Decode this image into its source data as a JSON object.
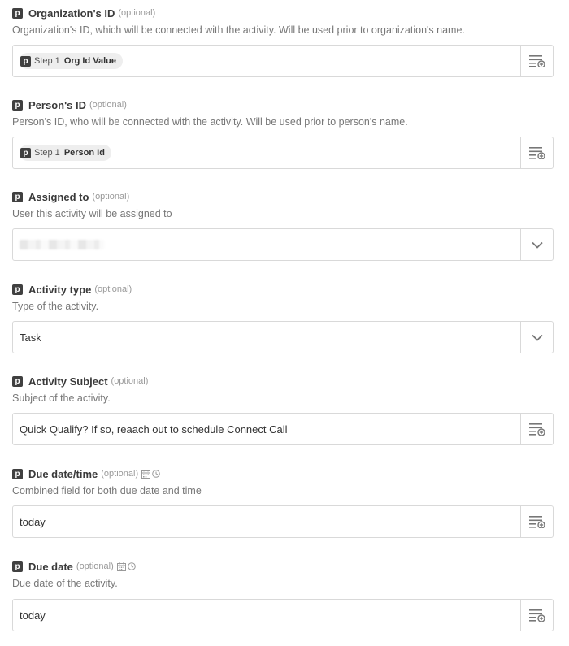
{
  "fields": [
    {
      "label": "Organization's ID",
      "optional": "(optional)",
      "description": "Organization's ID, which will be connected with the activity. Will be used prior to organization's name.",
      "pill": {
        "step": "Step 1",
        "value": "Org Id  Value"
      }
    },
    {
      "label": "Person's ID",
      "optional": "(optional)",
      "description": "Person's ID, who will be connected with the activity. Will be used prior to person's name.",
      "pill": {
        "step": "Step 1",
        "value": "Person  Id"
      }
    },
    {
      "label": "Assigned to",
      "optional": "(optional)",
      "description": "User this activity will be assigned to",
      "value": ""
    },
    {
      "label": "Activity type",
      "optional": "(optional)",
      "description": "Type of the activity.",
      "value": "Task"
    },
    {
      "label": "Activity Subject",
      "optional": "(optional)",
      "description": "Subject of the activity.",
      "value": "Quick Qualify? If so, reaach out to schedule Connect Call"
    },
    {
      "label": "Due date/time",
      "optional": "(optional)",
      "description": "Combined field for both due date and time",
      "value": "today"
    },
    {
      "label": "Due date",
      "optional": "(optional)",
      "description": "Due date of the activity.",
      "value": "today"
    }
  ],
  "app_badge": "p",
  "icons": {
    "field_menu": "list-plus-icon",
    "dropdown": "chevron-down-icon",
    "calendar": "calendar-icon",
    "clock": "clock-icon"
  },
  "colors": {
    "badge_bg": "#404040",
    "border": "#d9d9d9",
    "pill_bg": "#eeeeee"
  }
}
